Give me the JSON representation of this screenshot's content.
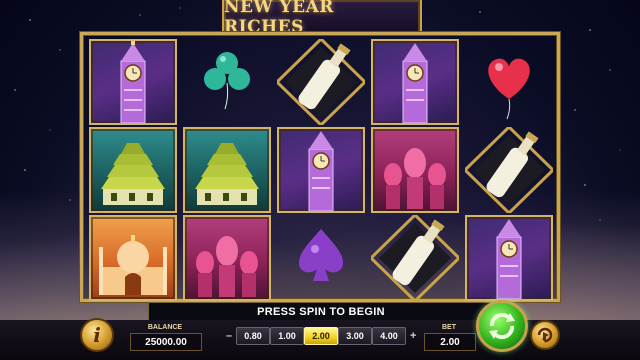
{
  "game": {
    "title": "NEW YEAR RICHES"
  },
  "reels": {
    "columns": [
      [
        "big-ben",
        "osaka-castle",
        "taj-mahal"
      ],
      [
        "clover-balloon",
        "osaka-castle",
        "moscow-cathedral"
      ],
      [
        "champagne",
        "big-ben",
        "spade-balloon"
      ],
      [
        "big-ben",
        "moscow-cathedral",
        "champagne"
      ],
      [
        "heart-balloon",
        "champagne",
        "big-ben"
      ]
    ]
  },
  "status": {
    "message": "PRESS SPIN TO BEGIN"
  },
  "panel": {
    "info_label": "i",
    "balance_label": "BALANCE",
    "balance_value": "25000.00",
    "bet_minus": "–",
    "bet_plus": "+",
    "bet_options": [
      "0.80",
      "1.00",
      "2.00",
      "3.00",
      "4.00"
    ],
    "bet_selected_index": 2,
    "bet_label": "BET",
    "bet_value": "2.00"
  },
  "colors": {
    "gold": "#caa757",
    "spin_green": "#32b41e",
    "active_bet": "#f5d21b"
  }
}
